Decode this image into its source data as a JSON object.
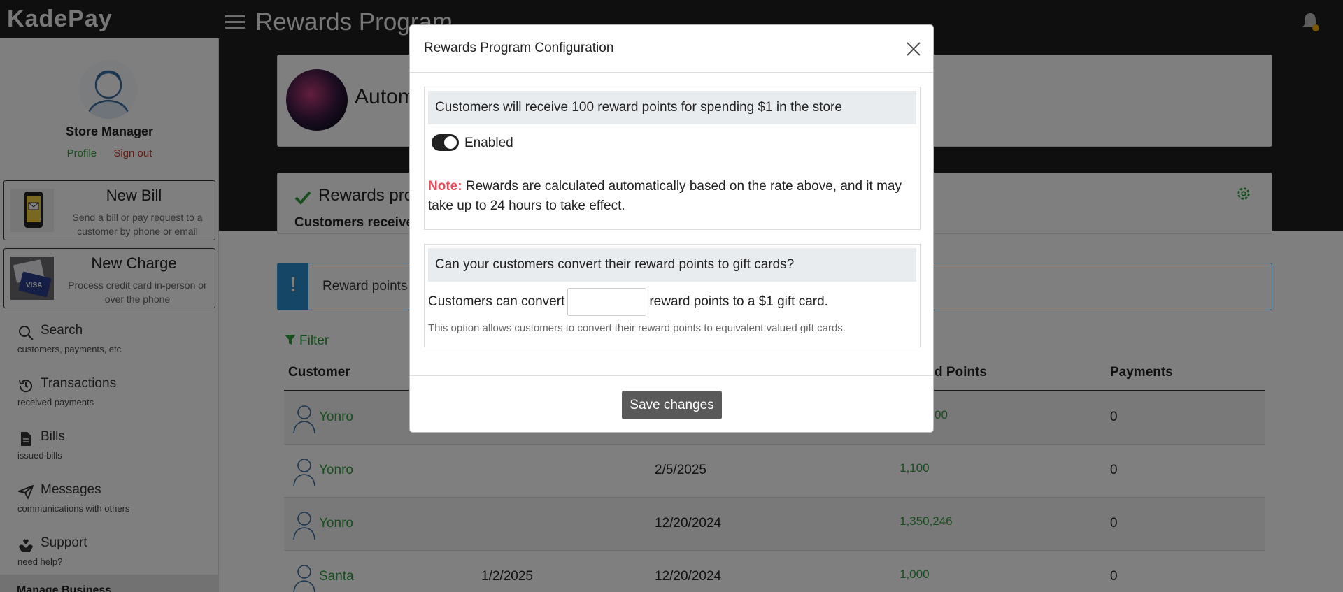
{
  "app": {
    "brand": "KadePay",
    "page_title": "Rewards Program"
  },
  "sidebar": {
    "user_name": "Store Manager",
    "profile_link": "Profile",
    "signout_link": "Sign out",
    "actions": [
      {
        "title": "New Bill",
        "desc": "Send a bill or pay request to a customer by phone or email"
      },
      {
        "title": "New Charge",
        "desc": "Process credit card in-person or over the phone"
      }
    ],
    "nav": [
      {
        "label": "Search",
        "sub": "customers, payments, etc"
      },
      {
        "label": "Transactions",
        "sub": "received payments"
      },
      {
        "label": "Bills",
        "sub": "issued bills"
      },
      {
        "label": "Messages",
        "sub": "communications with others"
      },
      {
        "label": "Support",
        "sub": "need help?"
      }
    ],
    "manage_business": "Manage Business"
  },
  "main": {
    "business_name": "Autom",
    "rewards_title": "Rewards pro",
    "rewards_summary": "Customers receive",
    "alert_text": "Reward points",
    "filter_label": "Filter",
    "columns": [
      "Customer",
      "d Points",
      "Payments"
    ],
    "rows": [
      {
        "customer": "Yonro",
        "joined": "",
        "last": "",
        "points": "00",
        "payments": "0"
      },
      {
        "customer": "Yonro",
        "joined": "",
        "last": "2/5/2025",
        "points": "1,100",
        "payments": "0"
      },
      {
        "customer": "Yonro",
        "joined": "",
        "last": "12/20/2024",
        "points": "1,350,246",
        "payments": "0"
      },
      {
        "customer": "Santa",
        "joined": "1/2/2025",
        "last": "12/20/2024",
        "points": "1,000",
        "payments": "0"
      }
    ]
  },
  "modal": {
    "title": "Rewards Program Configuration",
    "rate_text": "Customers will receive 100 reward points for spending $1 in the store",
    "toggle_label": "Enabled",
    "toggle_on": true,
    "note_label": "Note:",
    "note_text": "Rewards are calculated automatically based on the rate above, and it may take up to 24 hours to take effect.",
    "convert_question": "Can your customers convert their reward points to gift cards?",
    "convert_prefix": "Customers can convert",
    "convert_value": "",
    "convert_suffix": "reward points to a $1 gift card.",
    "convert_help": "This option allows customers to convert their reward points to equivalent valued gift cards.",
    "save_label": "Save changes"
  },
  "colors": {
    "accent_green": "#2e9d3d",
    "note_red": "#e74c5c",
    "header_dark": "#1f1f1f",
    "info_blue": "#2a8ccc"
  }
}
